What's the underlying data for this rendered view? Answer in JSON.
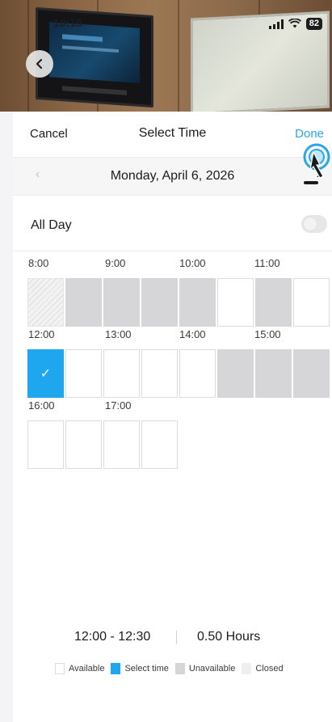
{
  "status_bar": {
    "time": "10:15",
    "battery": "82"
  },
  "header": {
    "cancel_label": "Cancel",
    "title": "Select Time",
    "done_label": "Done"
  },
  "date_nav": {
    "prev_label": "‹",
    "date": "Monday, April 6, 2026",
    "next_label": "›"
  },
  "all_day": {
    "label": "All Day",
    "enabled": false
  },
  "timeline": {
    "rows": [
      {
        "hours": [
          "8:00",
          "9:00",
          "10:00",
          "11:00"
        ],
        "slots": [
          "closed",
          "unavailable",
          "unavailable",
          "unavailable",
          "unavailable",
          "available",
          "unavailable",
          "available"
        ]
      },
      {
        "hours": [
          "12:00",
          "13:00",
          "14:00",
          "15:00"
        ],
        "slots": [
          "selected",
          "available",
          "available",
          "available",
          "available",
          "unavailable",
          "unavailable",
          "unavailable"
        ]
      },
      {
        "hours": [
          "16:00",
          "17:00"
        ],
        "slots": [
          "available",
          "available",
          "available",
          "available"
        ]
      }
    ],
    "selected_mark": "✓"
  },
  "summary": {
    "range": "12:00 - 12:30",
    "duration": "0.50 Hours"
  },
  "legend": [
    {
      "key": "available",
      "label": "Available"
    },
    {
      "key": "selected",
      "label": "Select time"
    },
    {
      "key": "unavailable",
      "label": "Unavailable"
    },
    {
      "key": "closed",
      "label": "Closed"
    }
  ],
  "colors": {
    "accent": "#1ea6ef",
    "done_text": "#2aa6ea",
    "unavailable": "#d6d6d8",
    "available": "#ffffff"
  },
  "icons": {
    "back": "chevron-left-icon",
    "tap": "tap-gesture-icon"
  }
}
